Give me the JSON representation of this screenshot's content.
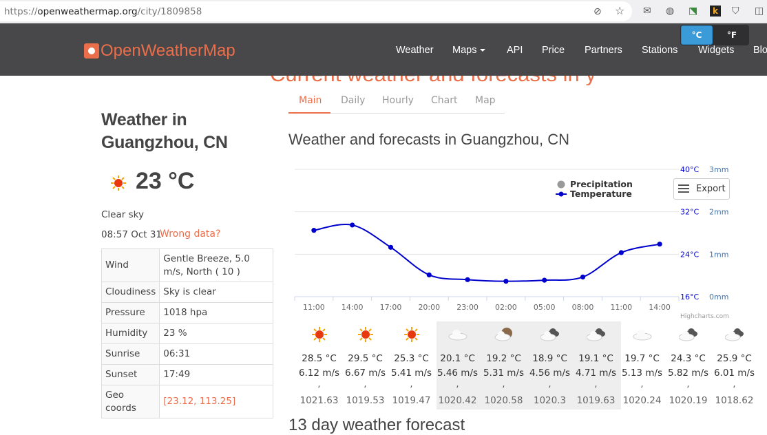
{
  "browser": {
    "url_prefix": "https://",
    "url_domain": "openweathermap.org",
    "url_path": "/city/1809858"
  },
  "units": {
    "celsius": "°C",
    "fahrenheit": "°F"
  },
  "logo": "OpenWeatherMap",
  "nav": [
    "Weather",
    "Maps",
    "API",
    "Price",
    "Partners",
    "Stations",
    "Widgets",
    "Blog"
  ],
  "cut_heading": "Current weather and forecasts in your city",
  "current": {
    "title": "Weather in Guangzhou, CN",
    "temp": "23 °C",
    "description": "Clear sky",
    "datetime": "08:57 Oct 31",
    "wrong_data": "Wrong data?",
    "rows": [
      {
        "label": "Wind",
        "value": "Gentle Breeze, 5.0 m/s, North ( 10 )"
      },
      {
        "label": "Cloudiness",
        "value": "Sky is clear"
      },
      {
        "label": "Pressure",
        "value": "1018 hpa"
      },
      {
        "label": "Humidity",
        "value": "23 %"
      },
      {
        "label": "Sunrise",
        "value": "06:31"
      },
      {
        "label": "Sunset",
        "value": "17:49"
      },
      {
        "label": "Geo coords",
        "value": "[23.12, 113.25]"
      }
    ]
  },
  "tabs": [
    "Main",
    "Daily",
    "Hourly",
    "Chart",
    "Map"
  ],
  "forecast_title": "Weather and forecasts in Guangzhou, CN",
  "export_label": "Export",
  "chart_data": {
    "type": "line",
    "x": [
      "11:00",
      "14:00",
      "17:00",
      "20:00",
      "23:00",
      "02:00",
      "05:00",
      "08:00",
      "11:00",
      "14:00"
    ],
    "series": [
      {
        "name": "Temperature",
        "values": [
          28.5,
          29.5,
          25.3,
          20.1,
          19.2,
          18.9,
          19.1,
          19.7,
          24.3,
          25.9
        ],
        "color": "#0000cc"
      },
      {
        "name": "Precipitation",
        "values": [
          0,
          0,
          0,
          0,
          0,
          0,
          0,
          0,
          0,
          0
        ],
        "color": "#999999"
      }
    ],
    "y_left": {
      "ticks": [
        "16°C",
        "24°C",
        "32°C",
        "40°C"
      ],
      "range": [
        16,
        40
      ]
    },
    "y_right": {
      "ticks": [
        "0mm",
        "1mm",
        "2mm",
        "3mm"
      ],
      "range": [
        0,
        3
      ]
    },
    "legend": [
      "Precipitation",
      "Temperature"
    ],
    "legend_position": "top-right",
    "credit": "Highcharts.com",
    "grid": true
  },
  "forecast_items": [
    {
      "icon": "sun",
      "temp": "28.5 °C",
      "wind": "6.12 m/s",
      "sep": ",",
      "pressure": "1021.63"
    },
    {
      "icon": "sun",
      "temp": "29.5 °C",
      "wind": "6.67 m/s",
      "sep": ",",
      "pressure": "1019.53"
    },
    {
      "icon": "sun",
      "temp": "25.3 °C",
      "wind": "5.41 m/s",
      "sep": ",",
      "pressure": "1019.47"
    },
    {
      "icon": "cloud",
      "temp": "20.1 °C",
      "wind": "5.46 m/s",
      "sep": ",",
      "pressure": "1020.42"
    },
    {
      "icon": "moon-cloud",
      "temp": "19.2 °C",
      "wind": "5.31 m/s",
      "sep": ",",
      "pressure": "1020.58"
    },
    {
      "icon": "dark-cloud",
      "temp": "18.9 °C",
      "wind": "4.56 m/s",
      "sep": ",",
      "pressure": "1020.3"
    },
    {
      "icon": "dark-cloud",
      "temp": "19.1 °C",
      "wind": "4.71 m/s",
      "sep": ",",
      "pressure": "1019.63"
    },
    {
      "icon": "cloud",
      "temp": "19.7 °C",
      "wind": "5.13 m/s",
      "sep": ",",
      "pressure": "1020.24"
    },
    {
      "icon": "dark-cloud",
      "temp": "24.3 °C",
      "wind": "5.82 m/s",
      "sep": ",",
      "pressure": "1020.19"
    },
    {
      "icon": "dark-cloud",
      "temp": "25.9 °C",
      "wind": "6.01 m/s",
      "sep": ",",
      "pressure": "1018.62"
    }
  ],
  "daily_title": "13 day weather forecast",
  "colors": {
    "brand": "#eb6e4b",
    "nav_bg": "#48484a",
    "accent_blue": "#3a9bd8",
    "temp_line": "#0000cc"
  }
}
